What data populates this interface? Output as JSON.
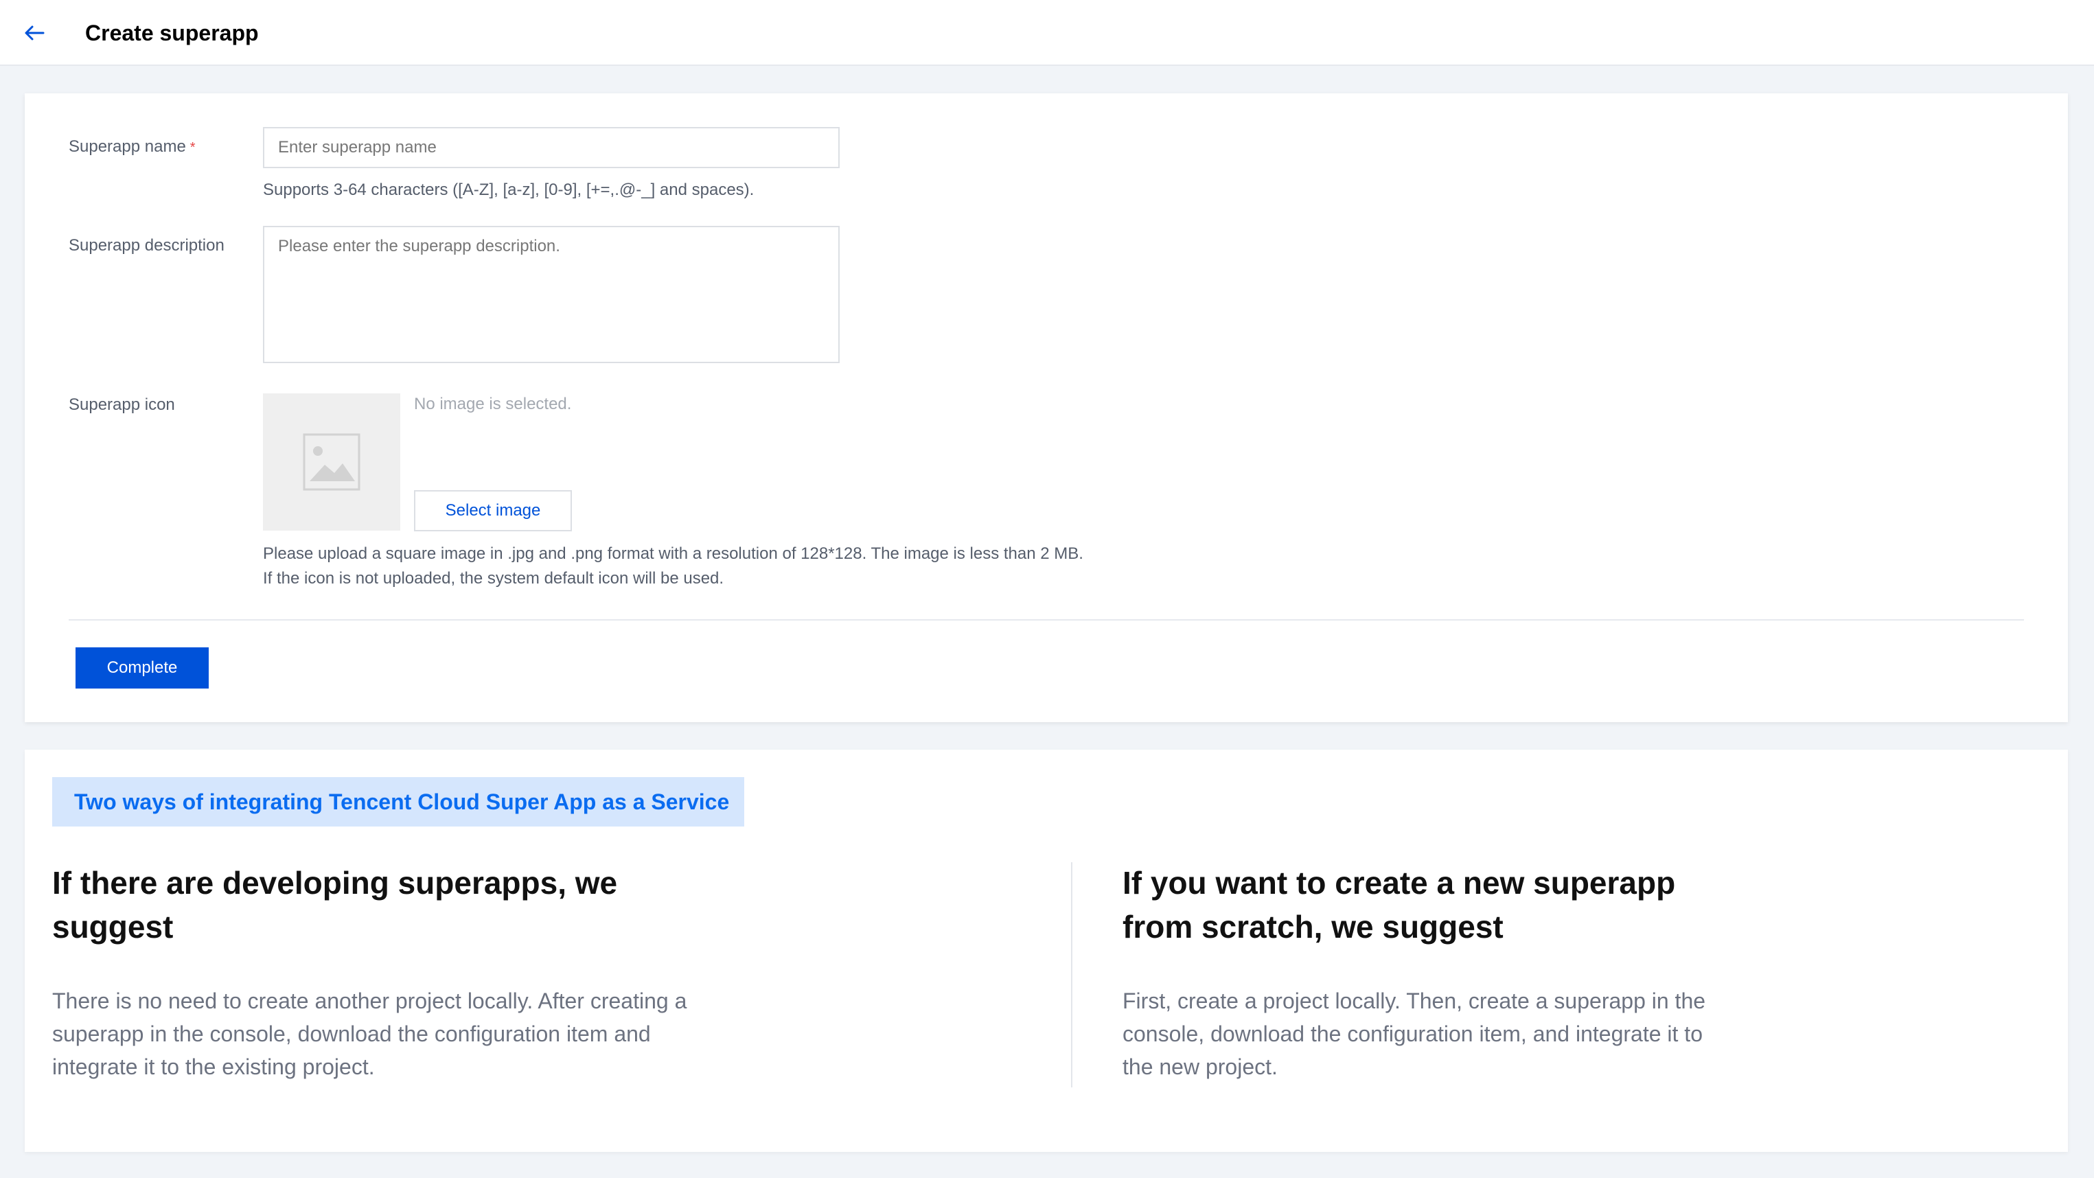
{
  "header": {
    "title": "Create superapp"
  },
  "form": {
    "name": {
      "label": "Superapp name",
      "required_mark": "*",
      "placeholder": "Enter superapp name",
      "hint": "Supports 3-64 characters ([A-Z], [a-z], [0-9], [+=,.@-_] and spaces)."
    },
    "description": {
      "label": "Superapp description",
      "placeholder": "Please enter the superapp description."
    },
    "icon": {
      "label": "Superapp icon",
      "status": "No image is selected.",
      "select_button": "Select image",
      "hint_line1": "Please upload a square image in .jpg and .png format with a resolution of 128*128. The image is less than 2 MB.",
      "hint_line2": "If the icon is not uploaded, the system default icon will be used."
    },
    "submit_label": "Complete"
  },
  "info": {
    "banner": "Two ways of integrating Tencent Cloud Super App as a Service",
    "left": {
      "title": "If there are developing superapps, we suggest",
      "body": "There is no need to create another project locally. After creating a superapp in the console, download the configuration item and integrate it to the existing project."
    },
    "right": {
      "title": "If you want to create a new superapp from scratch, we suggest",
      "body": "First, create a project locally. Then, create a superapp in the console, download the configuration item, and integrate it to the new project."
    }
  },
  "colors": {
    "accent": "#0052d9",
    "banner_bg": "#d5e6fd",
    "banner_text": "#0a6cf0",
    "required": "#e54545"
  },
  "icons": {
    "back": "arrow-left-icon",
    "image_placeholder": "image-placeholder-icon"
  }
}
